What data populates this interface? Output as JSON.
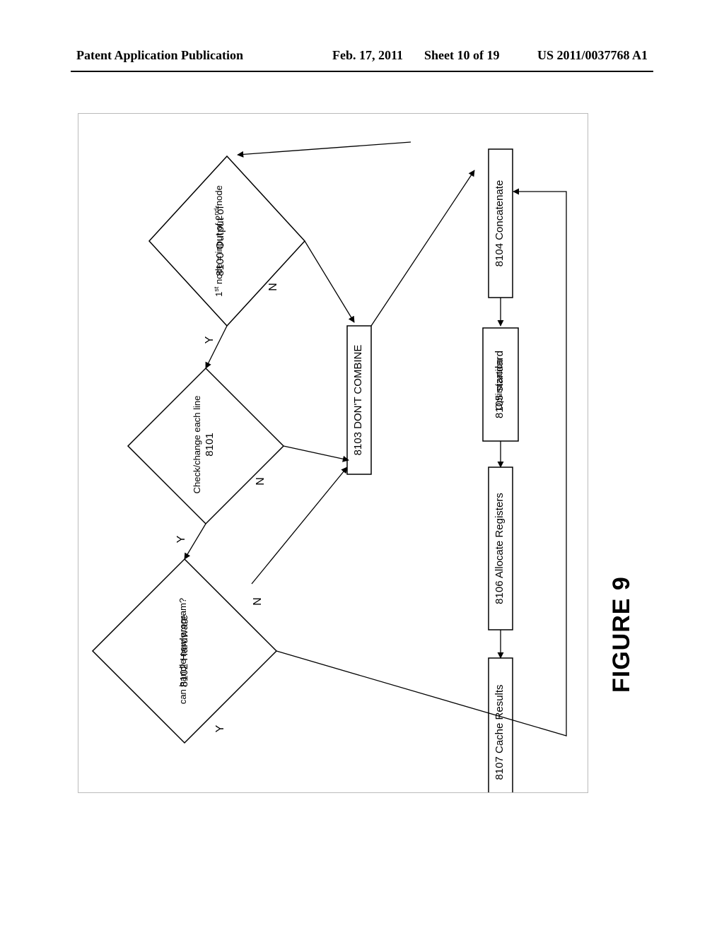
{
  "header": {
    "left": "Patent Application Publication",
    "date": "Feb. 17, 2011",
    "sheet": "Sheet 10 of 19",
    "pubno": "US 2011/0037768 A1"
  },
  "figure_label": "FIGURE 9",
  "nodes": {
    "d8100": {
      "ref": "8100",
      "line1": "Output of",
      "line2_a": "1",
      "line2_sup_a": "st",
      "line2_mid": " node = input of ",
      "line2_b": "2",
      "line2_sup_b": "nd",
      "line2_end": " node"
    },
    "d8101": {
      "ref": "8101",
      "text": "Check/change each line"
    },
    "d8102": {
      "ref": "8102",
      "line1": "Hardware",
      "line2": "can handle new program?"
    },
    "b8103": {
      "text": "8103 DON'T COMBINE"
    },
    "b8104": {
      "text": "8104 Concatenate"
    },
    "b8105": {
      "ref": "8105",
      "line1": "standard",
      "line2": "Optimization"
    },
    "b8106": {
      "text": "8106 Allocate Registers"
    },
    "b8107": {
      "text": "8107 Cache Results"
    }
  },
  "edge_labels": {
    "yes": "Y",
    "no": "N"
  },
  "chart_data": {
    "type": "flowchart",
    "orientation": "rotated-90-ccw",
    "nodes": [
      {
        "id": "8100",
        "shape": "decision",
        "label": "Output of 1st node = input of 2nd node"
      },
      {
        "id": "8101",
        "shape": "decision",
        "label": "Check/change each line"
      },
      {
        "id": "8102",
        "shape": "decision",
        "label": "Hardware can handle new program?"
      },
      {
        "id": "8103",
        "shape": "process",
        "label": "DON'T COMBINE"
      },
      {
        "id": "8104",
        "shape": "process",
        "label": "Concatenate"
      },
      {
        "id": "8105",
        "shape": "process",
        "label": "standard Optimization"
      },
      {
        "id": "8106",
        "shape": "process",
        "label": "Allocate Registers"
      },
      {
        "id": "8107",
        "shape": "process",
        "label": "Cache Results"
      }
    ],
    "edges": [
      {
        "from": "8100",
        "to": "8101",
        "label": "Y"
      },
      {
        "from": "8100",
        "to": "8103",
        "label": "N"
      },
      {
        "from": "8101",
        "to": "8102",
        "label": "Y"
      },
      {
        "from": "8101",
        "to": "8103",
        "label": "N"
      },
      {
        "from": "8102",
        "to": "8104",
        "label": "Y"
      },
      {
        "from": "8102",
        "to": "8103",
        "label": "N"
      },
      {
        "from": "8104",
        "to": "8105",
        "label": ""
      },
      {
        "from": "8105",
        "to": "8106",
        "label": ""
      },
      {
        "from": "8106",
        "to": "8107",
        "label": ""
      },
      {
        "from": "8103",
        "to": "8104",
        "label": ""
      }
    ]
  }
}
